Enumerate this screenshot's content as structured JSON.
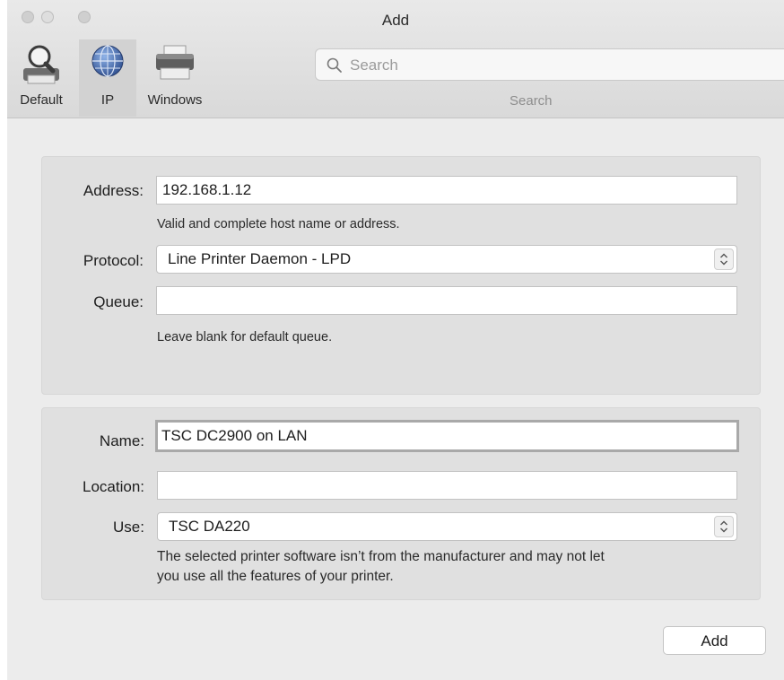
{
  "window": {
    "title": "Add"
  },
  "toolbar": {
    "items": [
      {
        "label": "Default",
        "icon": "magnifier-printer-icon"
      },
      {
        "label": "IP",
        "icon": "globe-icon",
        "selected": true
      },
      {
        "label": "Windows",
        "icon": "printer-icon"
      }
    ],
    "search": {
      "placeholder": "Search",
      "label": "Search",
      "value": ""
    }
  },
  "ip_group": {
    "address_label": "Address:",
    "address_value": "192.168.1.12",
    "address_hint": "Valid and complete host name or address.",
    "protocol_label": "Protocol:",
    "protocol_value": "Line Printer Daemon - LPD",
    "queue_label": "Queue:",
    "queue_value": "",
    "queue_hint": "Leave blank for default queue."
  },
  "printer_group": {
    "name_label": "Name:",
    "name_value": "TSC DC2900 on LAN",
    "location_label": "Location:",
    "location_value": "",
    "use_label": "Use:",
    "use_value": "TSC DA220",
    "use_hint_line1": "The selected printer software isn’t from the manufacturer and may not let",
    "use_hint_line2": "you use all the features of your printer."
  },
  "footer": {
    "add_label": "Add"
  }
}
